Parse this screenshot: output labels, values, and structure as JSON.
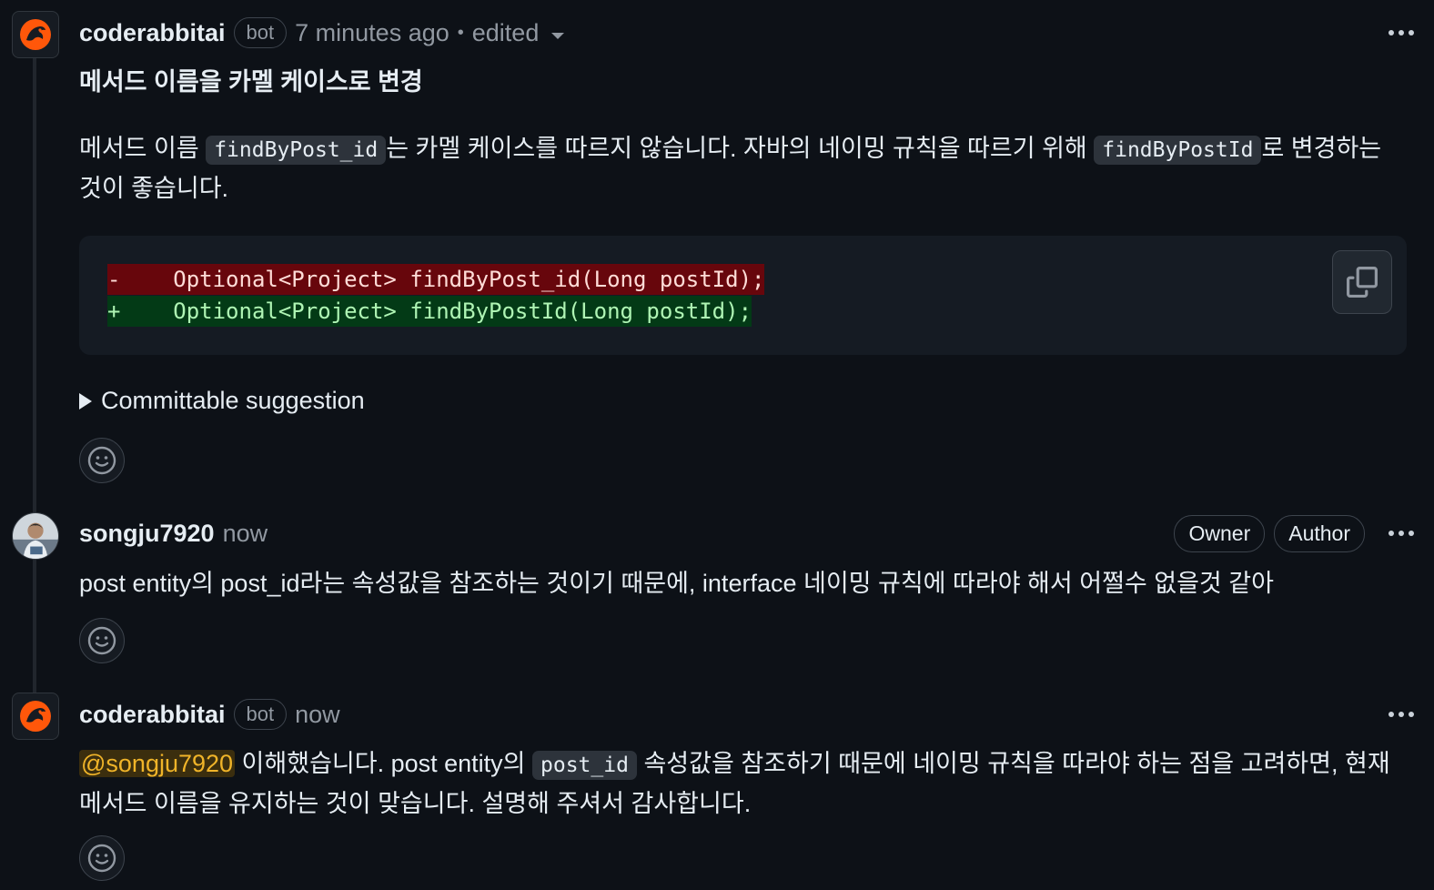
{
  "comments": [
    {
      "author": "coderabbitai",
      "badge": "bot",
      "time": "7 minutes ago",
      "separator": "•",
      "edited": "edited",
      "title": "메서드 이름을 카멜 케이스로 변경",
      "para_prefix": "메서드 이름 ",
      "code1": "findByPost_id",
      "para_mid": "는 카멜 케이스를 따르지 않습니다. 자바의 네이밍 규칙을 따르기 위해 ",
      "code2": "findByPostId",
      "para_suffix": "로 변경하는 것이 좋습니다.",
      "diff_removed": "-    Optional<Project> findByPost_id(Long postId);",
      "diff_added": "+    Optional<Project> findByPostId(Long postId);",
      "details_label": "Committable suggestion"
    },
    {
      "author": "songju7920",
      "time": "now",
      "badges": [
        "Owner",
        "Author"
      ],
      "text": "post entity의 post_id라는 속성값을 참조하는 것이기 때문에, interface 네이밍 규칙에 따라야 해서 어쩔수 없을것 같아"
    },
    {
      "author": "coderabbitai",
      "badge": "bot",
      "time": "now",
      "mention": "@songju7920",
      "text_prefix": " 이해했습니다. post entity의 ",
      "code": "post_id",
      "text_suffix": " 속성값을 참조하기 때문에 네이밍 규칙을 따라야 하는 점을 고려하면, 현재 메서드 이름을 유지하는 것이 맞습니다. 설명해 주셔서 감사합니다."
    }
  ],
  "icons": {
    "bot_avatar": "coderabbit-logo-icon",
    "more": "kebab-horizontal-icon",
    "copy": "copy-icon",
    "reaction": "smiley-icon",
    "dropdown": "triangle-down-icon",
    "disclosure": "triangle-right-icon"
  },
  "colors": {
    "background": "#0d1117",
    "diff_removed_bg": "#67060c",
    "diff_added_bg": "#033a16",
    "mention": "#f0b429",
    "muted": "#9198a1",
    "bot_brand": "#ff570a"
  }
}
